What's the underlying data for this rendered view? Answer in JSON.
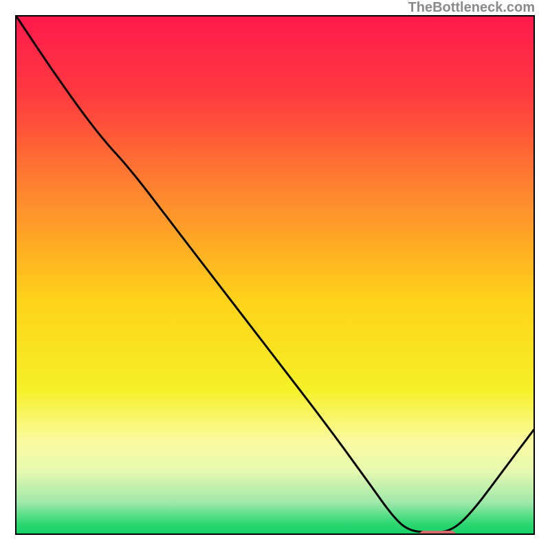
{
  "watermark": "TheBottleneck.com",
  "chart_data": {
    "type": "line",
    "title": "",
    "xlabel": "",
    "ylabel": "",
    "xlim": [
      0,
      100
    ],
    "ylim": [
      0,
      100
    ],
    "grid": false,
    "background_gradient_stops": [
      {
        "pos": 0.0,
        "color": "#ff1a4d"
      },
      {
        "pos": 0.15,
        "color": "#ff3a3f"
      },
      {
        "pos": 0.35,
        "color": "#ff8a2e"
      },
      {
        "pos": 0.55,
        "color": "#ffd31a"
      },
      {
        "pos": 0.72,
        "color": "#f5f025"
      },
      {
        "pos": 0.82,
        "color": "#fbfba0"
      },
      {
        "pos": 0.88,
        "color": "#e6f9b0"
      },
      {
        "pos": 0.94,
        "color": "#9fe8a9"
      },
      {
        "pos": 0.98,
        "color": "#2fd873"
      },
      {
        "pos": 1.0,
        "color": "#18cf67"
      }
    ],
    "series": [
      {
        "name": "bottleneck-curve",
        "color": "#000000",
        "points": [
          {
            "x": 0.0,
            "y": 100.0
          },
          {
            "x": 8.0,
            "y": 88.0
          },
          {
            "x": 16.0,
            "y": 77.0
          },
          {
            "x": 22.0,
            "y": 70.5
          },
          {
            "x": 30.0,
            "y": 60.0
          },
          {
            "x": 40.0,
            "y": 47.0
          },
          {
            "x": 50.0,
            "y": 34.0
          },
          {
            "x": 60.0,
            "y": 21.0
          },
          {
            "x": 68.0,
            "y": 10.0
          },
          {
            "x": 73.0,
            "y": 3.0
          },
          {
            "x": 76.0,
            "y": 0.5
          },
          {
            "x": 80.0,
            "y": 0.2
          },
          {
            "x": 84.0,
            "y": 0.4
          },
          {
            "x": 88.0,
            "y": 4.0
          },
          {
            "x": 94.0,
            "y": 12.0
          },
          {
            "x": 100.0,
            "y": 20.0
          }
        ]
      }
    ],
    "highlight_marker": {
      "x_start": 77.5,
      "x_end": 84.5,
      "y": 0.3,
      "color": "#d36a6d"
    }
  }
}
